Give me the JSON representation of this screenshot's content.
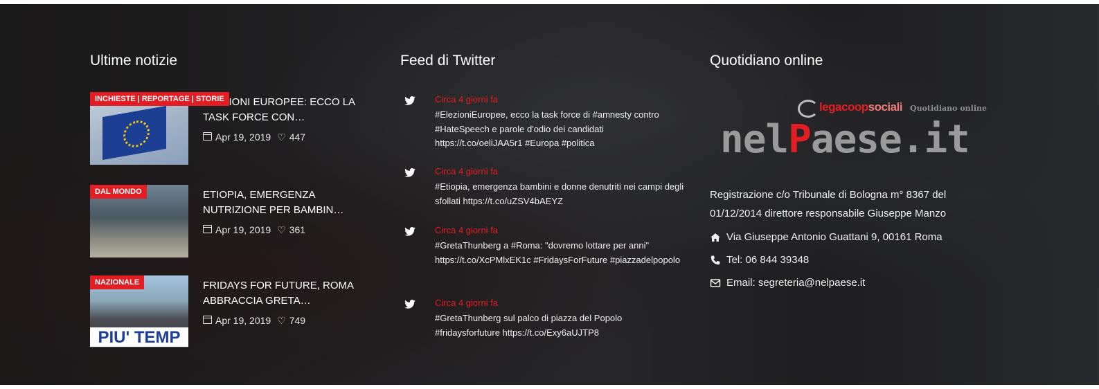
{
  "news": {
    "title": "Ultime notizie",
    "items": [
      {
        "category": "INCHIESTE | REPORTAGE | STORIE",
        "title": "ELEZIONI EUROPEE: ECCO LA TASK FORCE CON…",
        "date": "Apr 19, 2019",
        "likes": "447"
      },
      {
        "category": "DAL MONDO",
        "title": "ETIOPIA, EMERGENZA NUTRIZIONE PER BAMBIN…",
        "date": "Apr 19, 2019",
        "likes": "361"
      },
      {
        "category": "NAZIONALE",
        "title": "FRIDAYS FOR FUTURE, ROMA ABBRACCIA GRETA…",
        "date": "Apr 19, 2019",
        "likes": "749",
        "image_caption": "PIU' TEMP"
      }
    ]
  },
  "twitter": {
    "title": "Feed di Twitter",
    "tweets": [
      {
        "time": "Circa 4 giorni fa",
        "text": "#ElezioniEuropee, ecco la task force di #amnesty contro #HateSpeech e parole d'odio dei candidati https://t.co/oeliJAA5r1 #Europa #politica"
      },
      {
        "time": "Circa 4 giorni fa",
        "text": "#Etiopia, emergenza bambini e donne denutriti nei campi degli sfollati https://t.co/uZSV4bAEYZ"
      },
      {
        "time": "Circa 4 giorni fa",
        "text": "#GretaThunberg a #Roma: \"dovremo lottare per anni\" https://t.co/XcPMlxEK1c #FridaysForFuture #piazzadelpopolo"
      },
      {
        "time": "Circa 4 giorni fa",
        "text": "#GretaThunberg sul palco di piazza del Popolo #fridaysforfuture https://t.co/Exy6aUJTP8"
      }
    ]
  },
  "paper": {
    "title": "Quotidiano online",
    "lcs_legacoop": "legacoop",
    "lcs_sociali": "sociali",
    "lcs_sub": "Quotidiano online",
    "logo_part1": "nel",
    "logo_part2": "P",
    "logo_part3": "aese.it",
    "registration": "Registrazione c/o Tribunale di Bologna m° 8367 del 01/12/2014 direttore responsabile Giuseppe Manzo",
    "address": "Via Giuseppe Antonio Guattani 9, 00161 Roma",
    "phone": "Tel: 06 844 39348",
    "email": "Email: segreteria@nelpaese.it"
  },
  "colors": {
    "accent": "#e21d23",
    "text": "#ffffff",
    "overlay": "#0c0c0e"
  },
  "icons": [
    "calendar-icon",
    "heart-icon",
    "twitter-bird-icon",
    "home-icon",
    "phone-icon",
    "envelope-icon"
  ]
}
